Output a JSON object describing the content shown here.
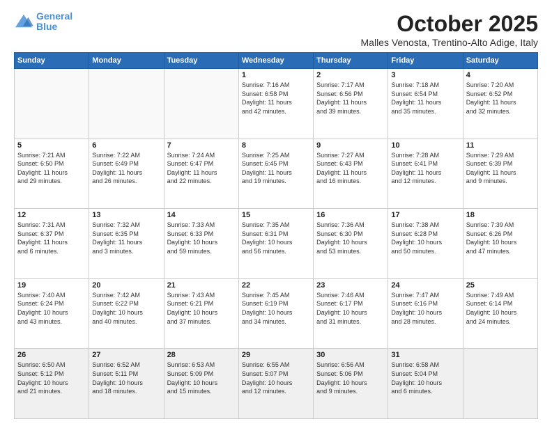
{
  "header": {
    "logo_line1": "General",
    "logo_line2": "Blue",
    "month": "October 2025",
    "location": "Malles Venosta, Trentino-Alto Adige, Italy"
  },
  "days_of_week": [
    "Sunday",
    "Monday",
    "Tuesday",
    "Wednesday",
    "Thursday",
    "Friday",
    "Saturday"
  ],
  "weeks": [
    [
      {
        "day": "",
        "info": ""
      },
      {
        "day": "",
        "info": ""
      },
      {
        "day": "",
        "info": ""
      },
      {
        "day": "1",
        "info": "Sunrise: 7:16 AM\nSunset: 6:58 PM\nDaylight: 11 hours\nand 42 minutes."
      },
      {
        "day": "2",
        "info": "Sunrise: 7:17 AM\nSunset: 6:56 PM\nDaylight: 11 hours\nand 39 minutes."
      },
      {
        "day": "3",
        "info": "Sunrise: 7:18 AM\nSunset: 6:54 PM\nDaylight: 11 hours\nand 35 minutes."
      },
      {
        "day": "4",
        "info": "Sunrise: 7:20 AM\nSunset: 6:52 PM\nDaylight: 11 hours\nand 32 minutes."
      }
    ],
    [
      {
        "day": "5",
        "info": "Sunrise: 7:21 AM\nSunset: 6:50 PM\nDaylight: 11 hours\nand 29 minutes."
      },
      {
        "day": "6",
        "info": "Sunrise: 7:22 AM\nSunset: 6:49 PM\nDaylight: 11 hours\nand 26 minutes."
      },
      {
        "day": "7",
        "info": "Sunrise: 7:24 AM\nSunset: 6:47 PM\nDaylight: 11 hours\nand 22 minutes."
      },
      {
        "day": "8",
        "info": "Sunrise: 7:25 AM\nSunset: 6:45 PM\nDaylight: 11 hours\nand 19 minutes."
      },
      {
        "day": "9",
        "info": "Sunrise: 7:27 AM\nSunset: 6:43 PM\nDaylight: 11 hours\nand 16 minutes."
      },
      {
        "day": "10",
        "info": "Sunrise: 7:28 AM\nSunset: 6:41 PM\nDaylight: 11 hours\nand 12 minutes."
      },
      {
        "day": "11",
        "info": "Sunrise: 7:29 AM\nSunset: 6:39 PM\nDaylight: 11 hours\nand 9 minutes."
      }
    ],
    [
      {
        "day": "12",
        "info": "Sunrise: 7:31 AM\nSunset: 6:37 PM\nDaylight: 11 hours\nand 6 minutes."
      },
      {
        "day": "13",
        "info": "Sunrise: 7:32 AM\nSunset: 6:35 PM\nDaylight: 11 hours\nand 3 minutes."
      },
      {
        "day": "14",
        "info": "Sunrise: 7:33 AM\nSunset: 6:33 PM\nDaylight: 10 hours\nand 59 minutes."
      },
      {
        "day": "15",
        "info": "Sunrise: 7:35 AM\nSunset: 6:31 PM\nDaylight: 10 hours\nand 56 minutes."
      },
      {
        "day": "16",
        "info": "Sunrise: 7:36 AM\nSunset: 6:30 PM\nDaylight: 10 hours\nand 53 minutes."
      },
      {
        "day": "17",
        "info": "Sunrise: 7:38 AM\nSunset: 6:28 PM\nDaylight: 10 hours\nand 50 minutes."
      },
      {
        "day": "18",
        "info": "Sunrise: 7:39 AM\nSunset: 6:26 PM\nDaylight: 10 hours\nand 47 minutes."
      }
    ],
    [
      {
        "day": "19",
        "info": "Sunrise: 7:40 AM\nSunset: 6:24 PM\nDaylight: 10 hours\nand 43 minutes."
      },
      {
        "day": "20",
        "info": "Sunrise: 7:42 AM\nSunset: 6:22 PM\nDaylight: 10 hours\nand 40 minutes."
      },
      {
        "day": "21",
        "info": "Sunrise: 7:43 AM\nSunset: 6:21 PM\nDaylight: 10 hours\nand 37 minutes."
      },
      {
        "day": "22",
        "info": "Sunrise: 7:45 AM\nSunset: 6:19 PM\nDaylight: 10 hours\nand 34 minutes."
      },
      {
        "day": "23",
        "info": "Sunrise: 7:46 AM\nSunset: 6:17 PM\nDaylight: 10 hours\nand 31 minutes."
      },
      {
        "day": "24",
        "info": "Sunrise: 7:47 AM\nSunset: 6:16 PM\nDaylight: 10 hours\nand 28 minutes."
      },
      {
        "day": "25",
        "info": "Sunrise: 7:49 AM\nSunset: 6:14 PM\nDaylight: 10 hours\nand 24 minutes."
      }
    ],
    [
      {
        "day": "26",
        "info": "Sunrise: 6:50 AM\nSunset: 5:12 PM\nDaylight: 10 hours\nand 21 minutes."
      },
      {
        "day": "27",
        "info": "Sunrise: 6:52 AM\nSunset: 5:11 PM\nDaylight: 10 hours\nand 18 minutes."
      },
      {
        "day": "28",
        "info": "Sunrise: 6:53 AM\nSunset: 5:09 PM\nDaylight: 10 hours\nand 15 minutes."
      },
      {
        "day": "29",
        "info": "Sunrise: 6:55 AM\nSunset: 5:07 PM\nDaylight: 10 hours\nand 12 minutes."
      },
      {
        "day": "30",
        "info": "Sunrise: 6:56 AM\nSunset: 5:06 PM\nDaylight: 10 hours\nand 9 minutes."
      },
      {
        "day": "31",
        "info": "Sunrise: 6:58 AM\nSunset: 5:04 PM\nDaylight: 10 hours\nand 6 minutes."
      },
      {
        "day": "",
        "info": ""
      }
    ]
  ]
}
